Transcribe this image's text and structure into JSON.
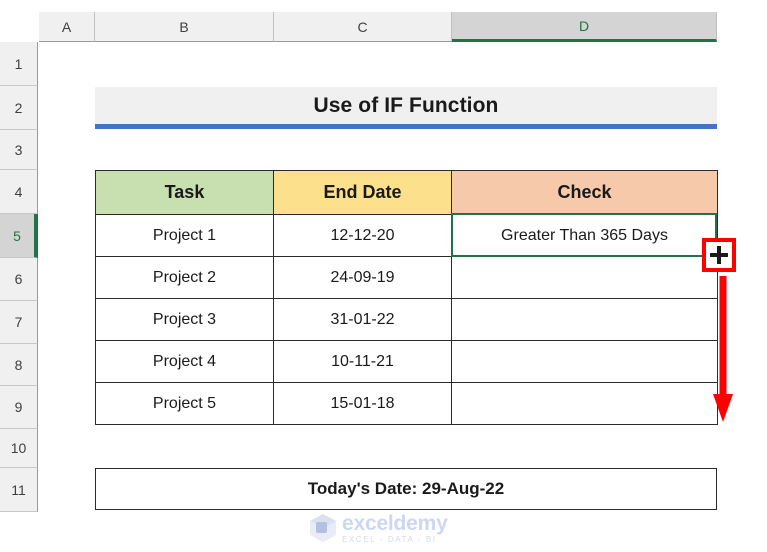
{
  "app": "excel-spreadsheet",
  "grid": {
    "columns": [
      {
        "label": "A",
        "selected": false
      },
      {
        "label": "B",
        "selected": false
      },
      {
        "label": "C",
        "selected": false
      },
      {
        "label": "D",
        "selected": true
      }
    ],
    "rows": [
      {
        "label": "1",
        "selected": false
      },
      {
        "label": "2",
        "selected": false
      },
      {
        "label": "3",
        "selected": false
      },
      {
        "label": "4",
        "selected": false
      },
      {
        "label": "5",
        "selected": true
      },
      {
        "label": "6",
        "selected": false
      },
      {
        "label": "7",
        "selected": false
      },
      {
        "label": "8",
        "selected": false
      },
      {
        "label": "9",
        "selected": false
      },
      {
        "label": "10",
        "selected": false
      },
      {
        "label": "11",
        "selected": false
      }
    ]
  },
  "title": {
    "text": "Use of IF Function",
    "underline_color": "#4573c4",
    "background": "#f0f0f0"
  },
  "table": {
    "headers": [
      {
        "label": "Task",
        "color": "#c8dfb0"
      },
      {
        "label": "End Date",
        "color": "#fce08c"
      },
      {
        "label": "Check",
        "color": "#f6c9aa"
      }
    ],
    "rows": [
      {
        "task": "Project 1",
        "end_date": "12-12-20",
        "check": "Greater Than 365 Days"
      },
      {
        "task": "Project 2",
        "end_date": "24-09-19",
        "check": ""
      },
      {
        "task": "Project 3",
        "end_date": "31-01-22",
        "check": ""
      },
      {
        "task": "Project 4",
        "end_date": "10-11-21",
        "check": ""
      },
      {
        "task": "Project 5",
        "end_date": "15-01-18",
        "check": ""
      }
    ]
  },
  "footer": {
    "text": "Today's Date: 29-Aug-22"
  },
  "annotations": {
    "fill_handle_cursor": "fill-handle-plus-cursor",
    "fill_handle_highlight_color": "#ff0000",
    "drag_arrow": "red-down-arrow",
    "drag_arrow_color": "#ff0000"
  },
  "selection": {
    "active_cell": "D5",
    "border_color": "#217346"
  },
  "watermark": {
    "name": "exceldemy",
    "tagline": "EXCEL - DATA - BI"
  }
}
